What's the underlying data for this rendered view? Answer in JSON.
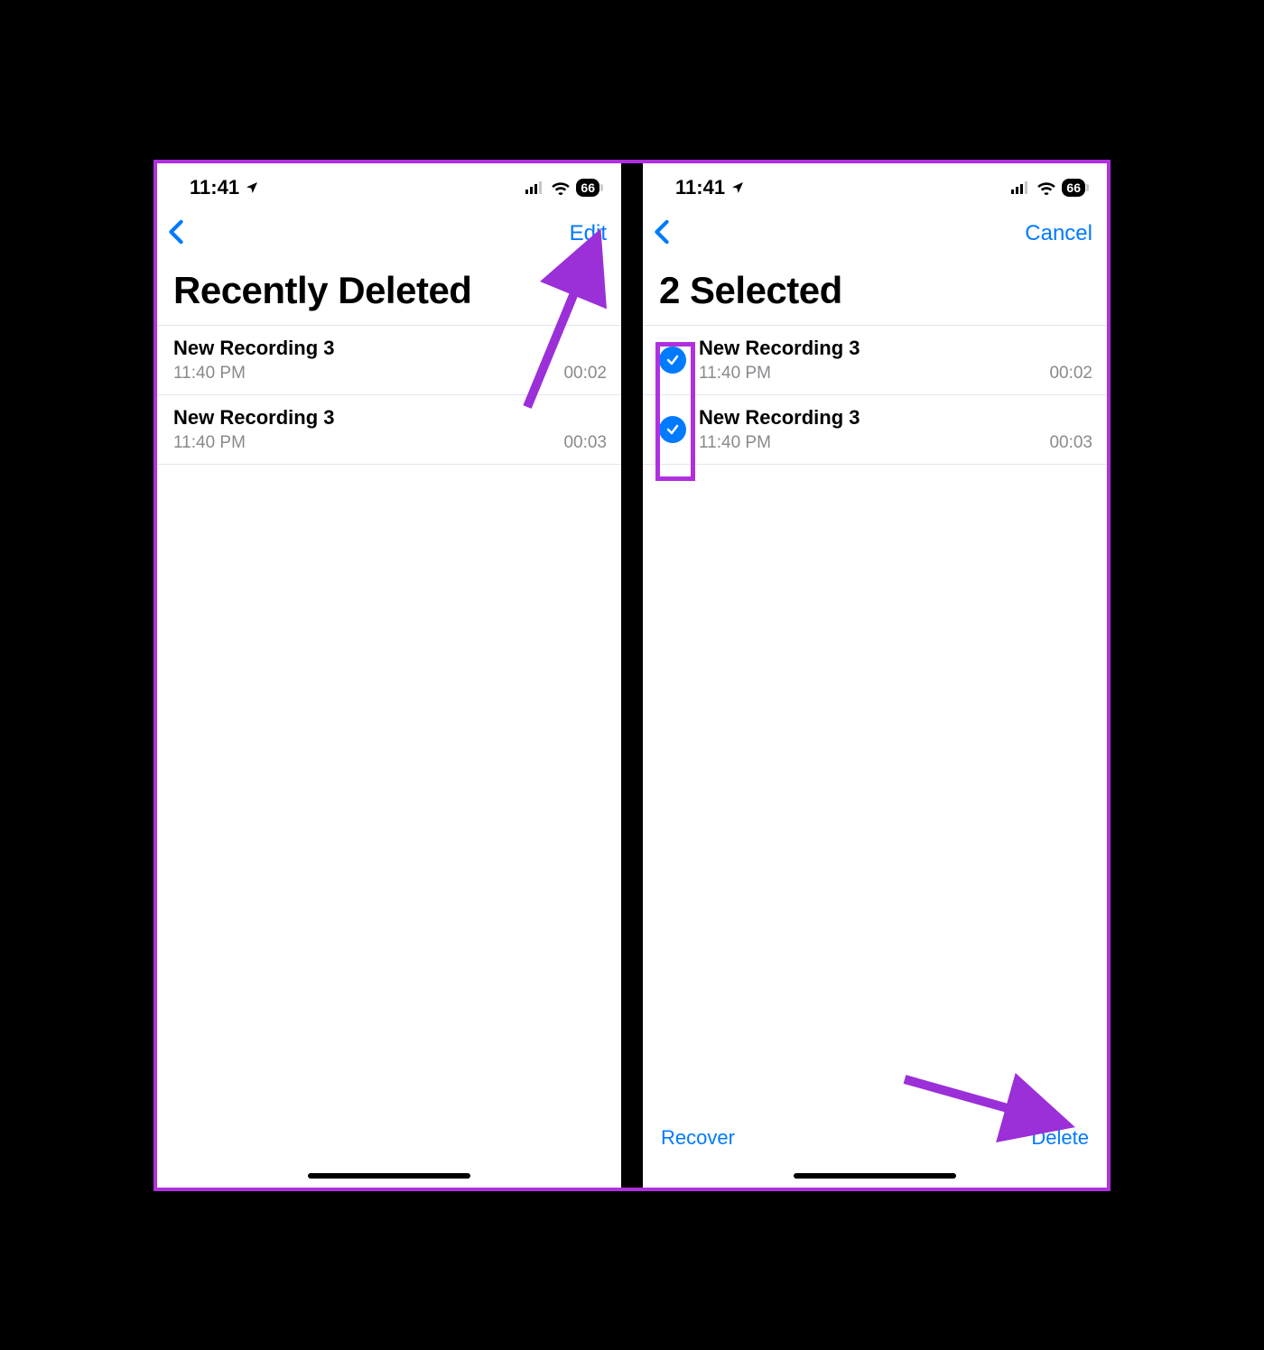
{
  "left": {
    "status": {
      "time": "11:41",
      "battery": "66"
    },
    "nav": {
      "edit": "Edit"
    },
    "title": "Recently Deleted",
    "recordings": [
      {
        "name": "New Recording 3",
        "time": "11:40 PM",
        "duration": "00:02"
      },
      {
        "name": "New Recording 3",
        "time": "11:40 PM",
        "duration": "00:03"
      }
    ]
  },
  "right": {
    "status": {
      "time": "11:41",
      "battery": "66"
    },
    "nav": {
      "cancel": "Cancel"
    },
    "title": "2 Selected",
    "recordings": [
      {
        "name": "New Recording 3",
        "time": "11:40 PM",
        "duration": "00:02",
        "selected": true
      },
      {
        "name": "New Recording 3",
        "time": "11:40 PM",
        "duration": "00:03",
        "selected": true
      }
    ],
    "toolbar": {
      "recover": "Recover",
      "delete": "Delete"
    }
  },
  "colors": {
    "accent": "#007aff",
    "highlight": "#b030e0"
  }
}
